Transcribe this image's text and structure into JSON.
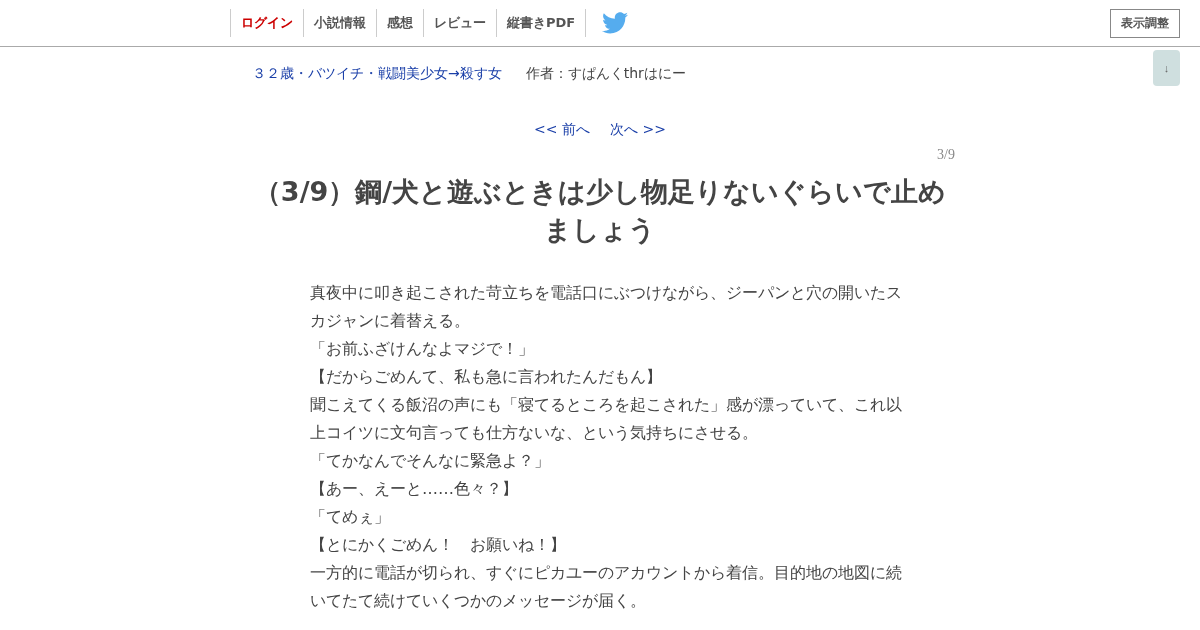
{
  "nav": {
    "items": [
      {
        "label": "ログイン",
        "kind": "login"
      },
      {
        "label": "小説情報",
        "kind": "link"
      },
      {
        "label": "感想",
        "kind": "link"
      },
      {
        "label": "レビュー",
        "kind": "link"
      },
      {
        "label": "縦書きPDF",
        "kind": "link"
      }
    ],
    "settings_button": "表示調整",
    "scroll_button": "↓"
  },
  "novel": {
    "title": "３２歳・バツイチ・戦闘美少女→殺す女",
    "author": "作者：すぱんくthrはにー"
  },
  "pager": {
    "prev": "<< 前へ",
    "next": "次へ >>",
    "position": "3/9"
  },
  "chapter_title": "（3/9）鋼/犬と遊ぶときは少し物足りないぐらいで止めましょう",
  "paragraphs": [
    "真夜中に叩き起こされた苛立ちを電話口にぶつけながら、ジーパンと穴の開いたスカジャンに着替える。",
    "「お前ふざけんなよマジで！」",
    "【だからごめんて、私も急に言われたんだもん】",
    "聞こえてくる飯沼の声にも「寝てるところを起こされた」感が漂っていて、これ以上コイツに文句言っても仕方ないな、という気持ちにさせる。",
    "「てかなんでそんなに緊急よ？」",
    "【あー、えーと……色々？】",
    "「てめぇ」",
    "【とにかくごめん！　お願いね！】",
    "一方的に電話が切られ、すぐにピカユーのアカウントから着信。目的地の地図に続いてたて続けていくつかのメッセージが届く。"
  ]
}
